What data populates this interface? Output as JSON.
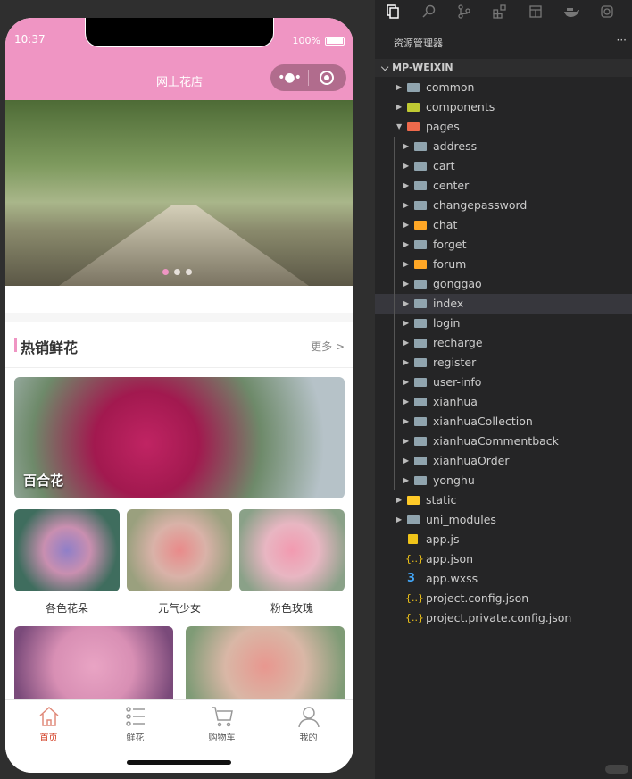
{
  "phone": {
    "time": "10:37",
    "battery": "100%",
    "title": "网上花店",
    "capsule_more": "•●•",
    "section": {
      "title": "热销鲜花",
      "more": "更多 >"
    },
    "featured": {
      "name": "百合花"
    },
    "products": [
      {
        "name": "各色花朵"
      },
      {
        "name": "元气少女"
      },
      {
        "name": "粉色玫瑰"
      }
    ],
    "tabs": [
      {
        "label": "首页"
      },
      {
        "label": "鲜花"
      },
      {
        "label": "购物车"
      },
      {
        "label": "我的"
      }
    ],
    "accent": "#ef95c3",
    "active_tab_color": "#d23b20"
  },
  "ide": {
    "panel_title": "资源管理器",
    "more": "···",
    "root": "MP-WEIXIN",
    "tree": [
      {
        "name": "common",
        "level": 1,
        "type": "folder",
        "expanded": false
      },
      {
        "name": "components",
        "level": 1,
        "type": "folder-components",
        "expanded": false
      },
      {
        "name": "pages",
        "level": 1,
        "type": "folder-pages",
        "expanded": true
      },
      {
        "name": "address",
        "level": 2,
        "type": "folder"
      },
      {
        "name": "cart",
        "level": 2,
        "type": "folder"
      },
      {
        "name": "center",
        "level": 2,
        "type": "folder"
      },
      {
        "name": "changepassword",
        "level": 2,
        "type": "folder"
      },
      {
        "name": "chat",
        "level": 2,
        "type": "folder-orange"
      },
      {
        "name": "forget",
        "level": 2,
        "type": "folder"
      },
      {
        "name": "forum",
        "level": 2,
        "type": "folder-orange"
      },
      {
        "name": "gonggao",
        "level": 2,
        "type": "folder"
      },
      {
        "name": "index",
        "level": 2,
        "type": "folder",
        "selected": true
      },
      {
        "name": "login",
        "level": 2,
        "type": "folder"
      },
      {
        "name": "recharge",
        "level": 2,
        "type": "folder"
      },
      {
        "name": "register",
        "level": 2,
        "type": "folder"
      },
      {
        "name": "user-info",
        "level": 2,
        "type": "folder"
      },
      {
        "name": "xianhua",
        "level": 2,
        "type": "folder"
      },
      {
        "name": "xianhuaCollection",
        "level": 2,
        "type": "folder"
      },
      {
        "name": "xianhuaCommentback",
        "level": 2,
        "type": "folder"
      },
      {
        "name": "xianhuaOrder",
        "level": 2,
        "type": "folder"
      },
      {
        "name": "yonghu",
        "level": 2,
        "type": "folder"
      },
      {
        "name": "static",
        "level": 1,
        "type": "folder-static",
        "expanded": false
      },
      {
        "name": "uni_modules",
        "level": 1,
        "type": "folder",
        "expanded": false
      },
      {
        "name": "app.js",
        "level": 1,
        "type": "js"
      },
      {
        "name": "app.json",
        "level": 1,
        "type": "json"
      },
      {
        "name": "app.wxss",
        "level": 1,
        "type": "css"
      },
      {
        "name": "project.config.json",
        "level": 1,
        "type": "json"
      },
      {
        "name": "project.private.config.json",
        "level": 1,
        "type": "json"
      }
    ]
  }
}
